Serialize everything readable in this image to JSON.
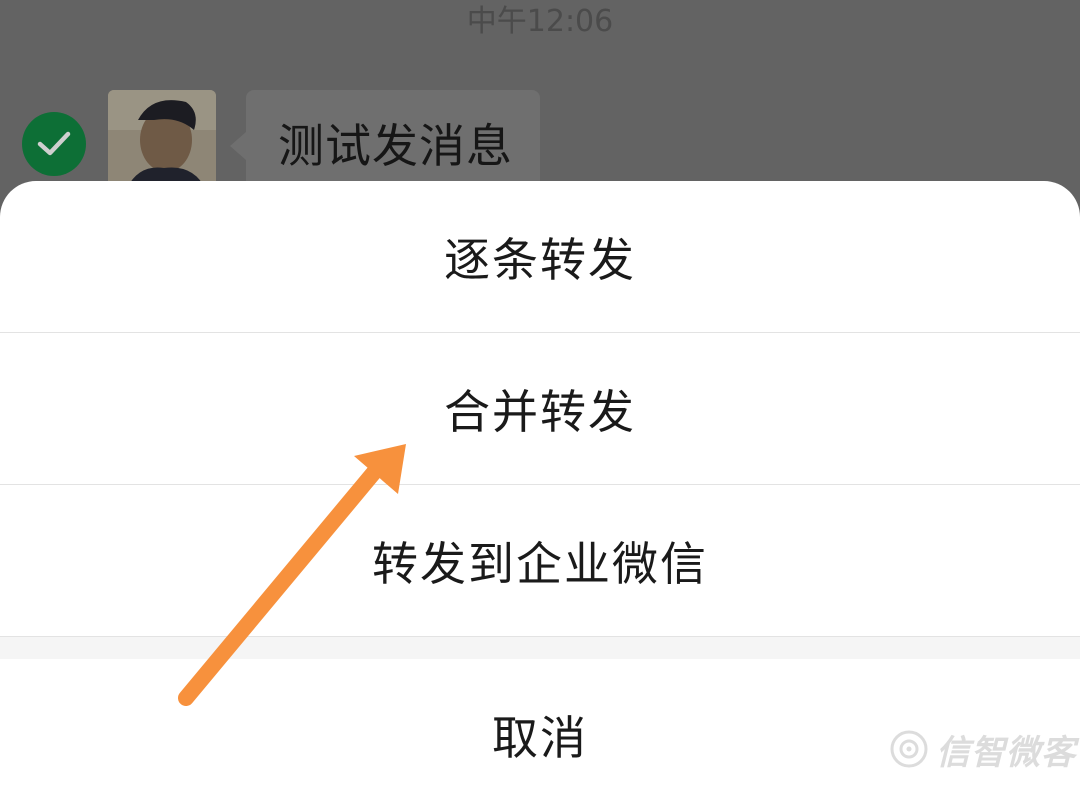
{
  "chat": {
    "timestamp": "中午12:06",
    "message_text": "测试发消息",
    "selected": true
  },
  "action_sheet": {
    "options": [
      {
        "label": "逐条转发"
      },
      {
        "label": "合并转发"
      },
      {
        "label": "转发到企业微信"
      }
    ],
    "cancel_label": "取消"
  },
  "annotation": {
    "arrow_color": "#f7913d",
    "arrow_target": "合并转发"
  },
  "watermark": {
    "text": "信智微客"
  },
  "colors": {
    "overlay_bg": "#636363",
    "check_green": "#0d6f36",
    "sheet_bg": "#ffffff"
  }
}
